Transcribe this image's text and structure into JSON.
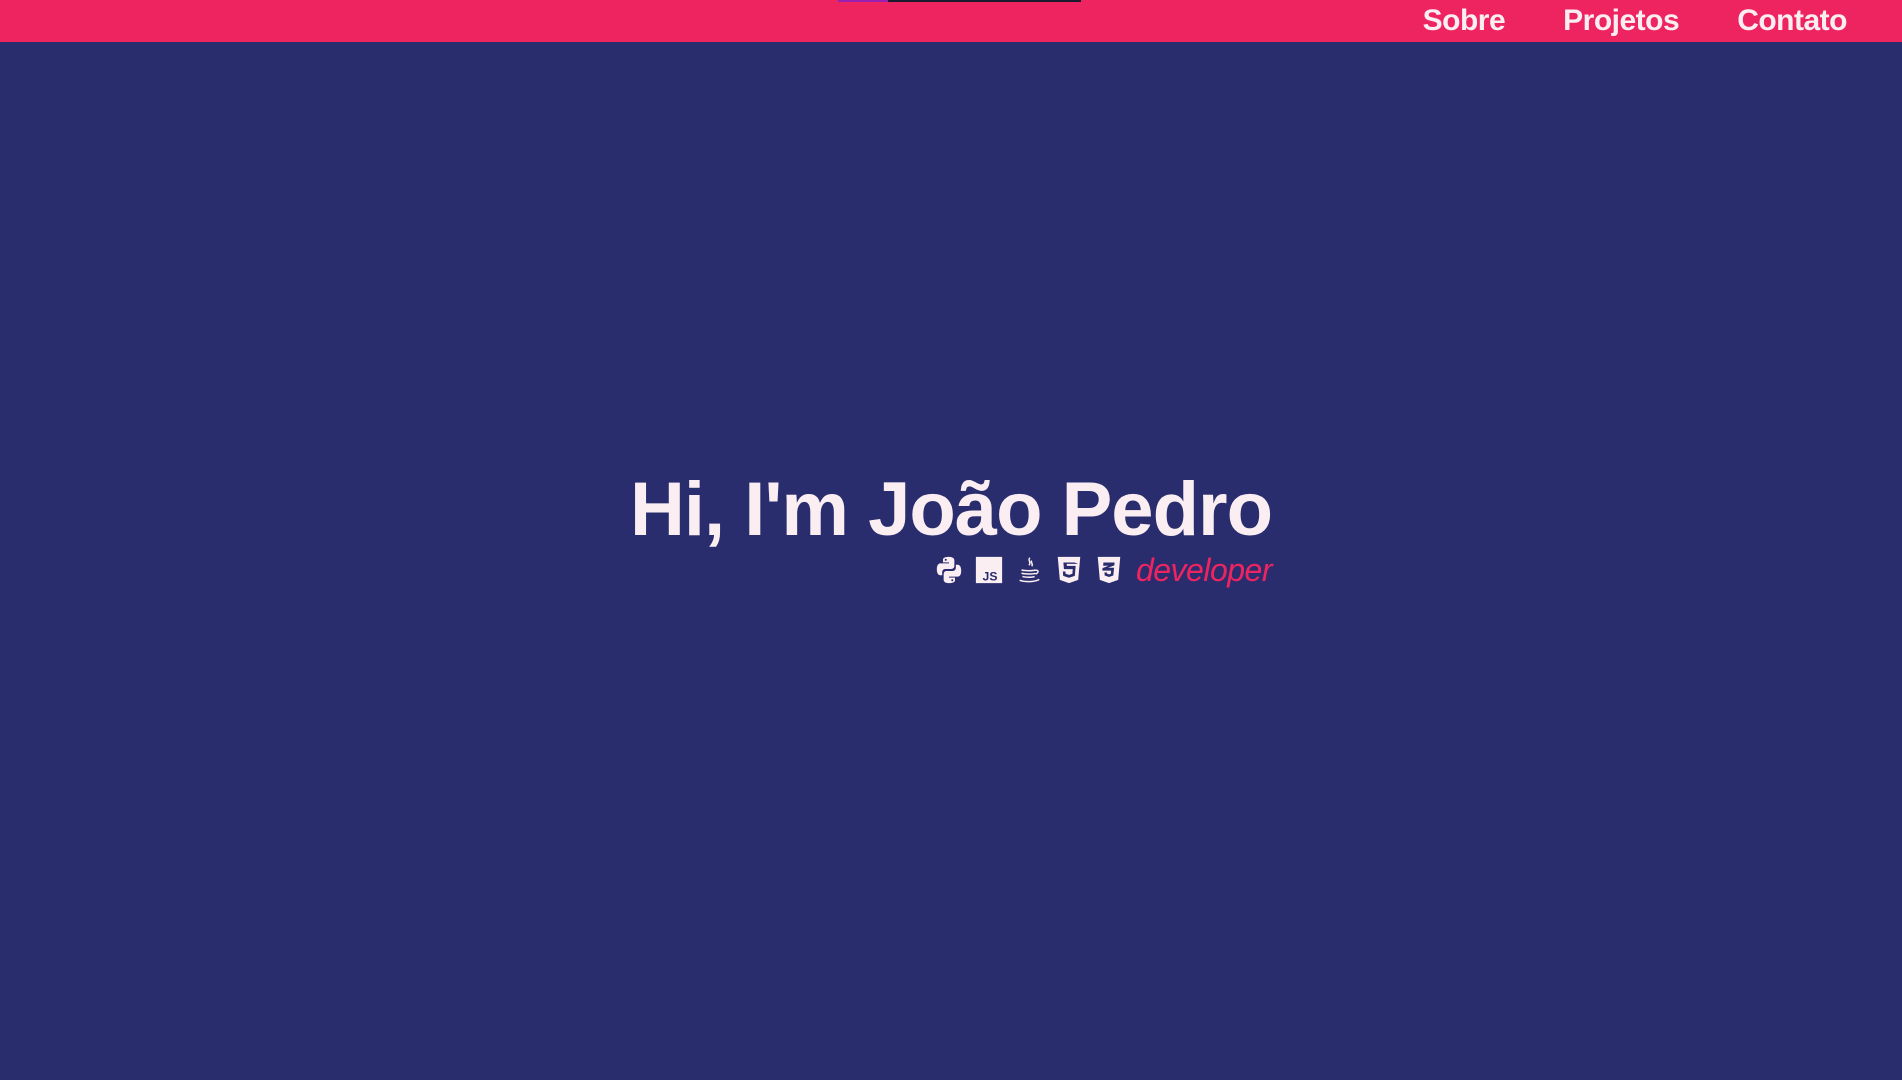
{
  "nav": {
    "items": [
      {
        "label": "Sobre"
      },
      {
        "label": "Projetos"
      },
      {
        "label": "Contato"
      }
    ]
  },
  "hero": {
    "title": "Hi, I'm João Pedro",
    "role": "developer",
    "tech_icons": [
      "python-icon",
      "javascript-icon",
      "java-icon",
      "html5-icon",
      "css3-icon"
    ]
  },
  "colors": {
    "background": "#292d6e",
    "accent": "#ee2461",
    "text": "#fbeef2"
  }
}
